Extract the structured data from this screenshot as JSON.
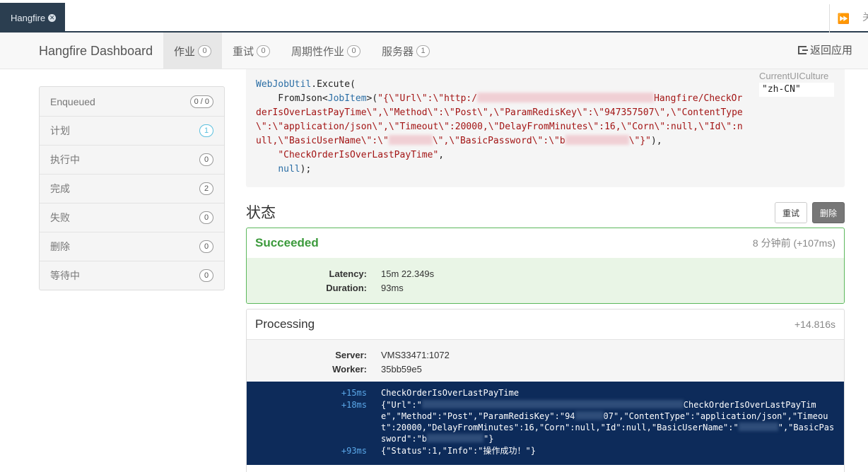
{
  "browser_tab": {
    "title": "Hangfire"
  },
  "navbar": {
    "brand": "Hangfire Dashboard",
    "items": [
      {
        "label": "作业",
        "count": "0",
        "active": true
      },
      {
        "label": "重试",
        "count": "0"
      },
      {
        "label": "周期性作业",
        "count": "0"
      },
      {
        "label": "服务器",
        "count": "1"
      }
    ],
    "back_label": "返回应用"
  },
  "sidebar": {
    "items": [
      {
        "label": "Enqueued",
        "count": "0 / 0"
      },
      {
        "label": "计划",
        "count": "1"
      },
      {
        "label": "执行中",
        "count": "0"
      },
      {
        "label": "完成",
        "count": "2"
      },
      {
        "label": "失败",
        "count": "0"
      },
      {
        "label": "删除",
        "count": "0"
      },
      {
        "label": "等待中",
        "count": "0"
      }
    ]
  },
  "job_code": {
    "line1_class": "WebJobUtil",
    "line1_method": ".Excute(",
    "line2_prefix": "    FromJson<",
    "line2_type": "JobItem",
    "line2_mid": ">(",
    "line2_str_a": "\"{\\\"Url\\\":\\\"http:/",
    "line2_str_b": "Hangfire/CheckOr",
    "line3": "derIsOverLastPayTime\\\",\\\"Method\\\":\\\"Post\\\",\\\"ParamRedisKey\\\":\\\"947357507\\\",\\\"ContentType",
    "line4": "\\\":\\\"application/json\\\",\\\"Timeout\\\":20000,\\\"DelayFromMinutes\\\":16,\\\"Corn\\\":null,\\\"Id\\\":n",
    "line5_a": "ull,\\\"BasicUserName\\\":\\\"",
    "line5_b": "\\\",\\\"BasicPassword\\\":\\\"b",
    "line5_c": "\\\"}\"",
    "line5_end": "),",
    "line6": "\"CheckOrderIsOverLastPayTime\"",
    "line6_end": ",",
    "line7": "null",
    "line7_end": ");",
    "culture_label": "CurrentUICulture",
    "culture_value": "\"zh-CN\""
  },
  "status": {
    "title": "状态",
    "retry_label": "重试",
    "delete_label": "删除"
  },
  "succeeded": {
    "name": "Succeeded",
    "time": "8 分钟前 (+107ms)",
    "latency_label": "Latency:",
    "latency_value": "15m 22.349s",
    "duration_label": "Duration:",
    "duration_value": "93ms"
  },
  "processing": {
    "name": "Processing",
    "time": "+14.816s",
    "server_label": "Server:",
    "server_value": "VMS33471:1072",
    "worker_label": "Worker:",
    "worker_value": "35bb59e5",
    "console": [
      {
        "t": "+15ms",
        "m": "CheckOrderIsOverLastPayTime"
      },
      {
        "t": "+18ms",
        "m1": "{\"Url\":\"",
        "m2": "CheckOrderIsOverLastPayTime\",\"Method\":\"Post\",\"ParamRedisKey\":\"94",
        "m3": "07\",\"ContentType\":\"application/json\",\"Timeout\":20000,\"DelayFromMinutes\":16,\"Corn\":null,\"Id\":null,\"BasicUserName\":\"",
        "m4": "\",\"BasicPassword\":\"b",
        "m5": "\"}"
      },
      {
        "t": "+93ms",
        "m": "{\"Status\":1,\"Info\":\"操作成功！\"}"
      }
    ]
  }
}
